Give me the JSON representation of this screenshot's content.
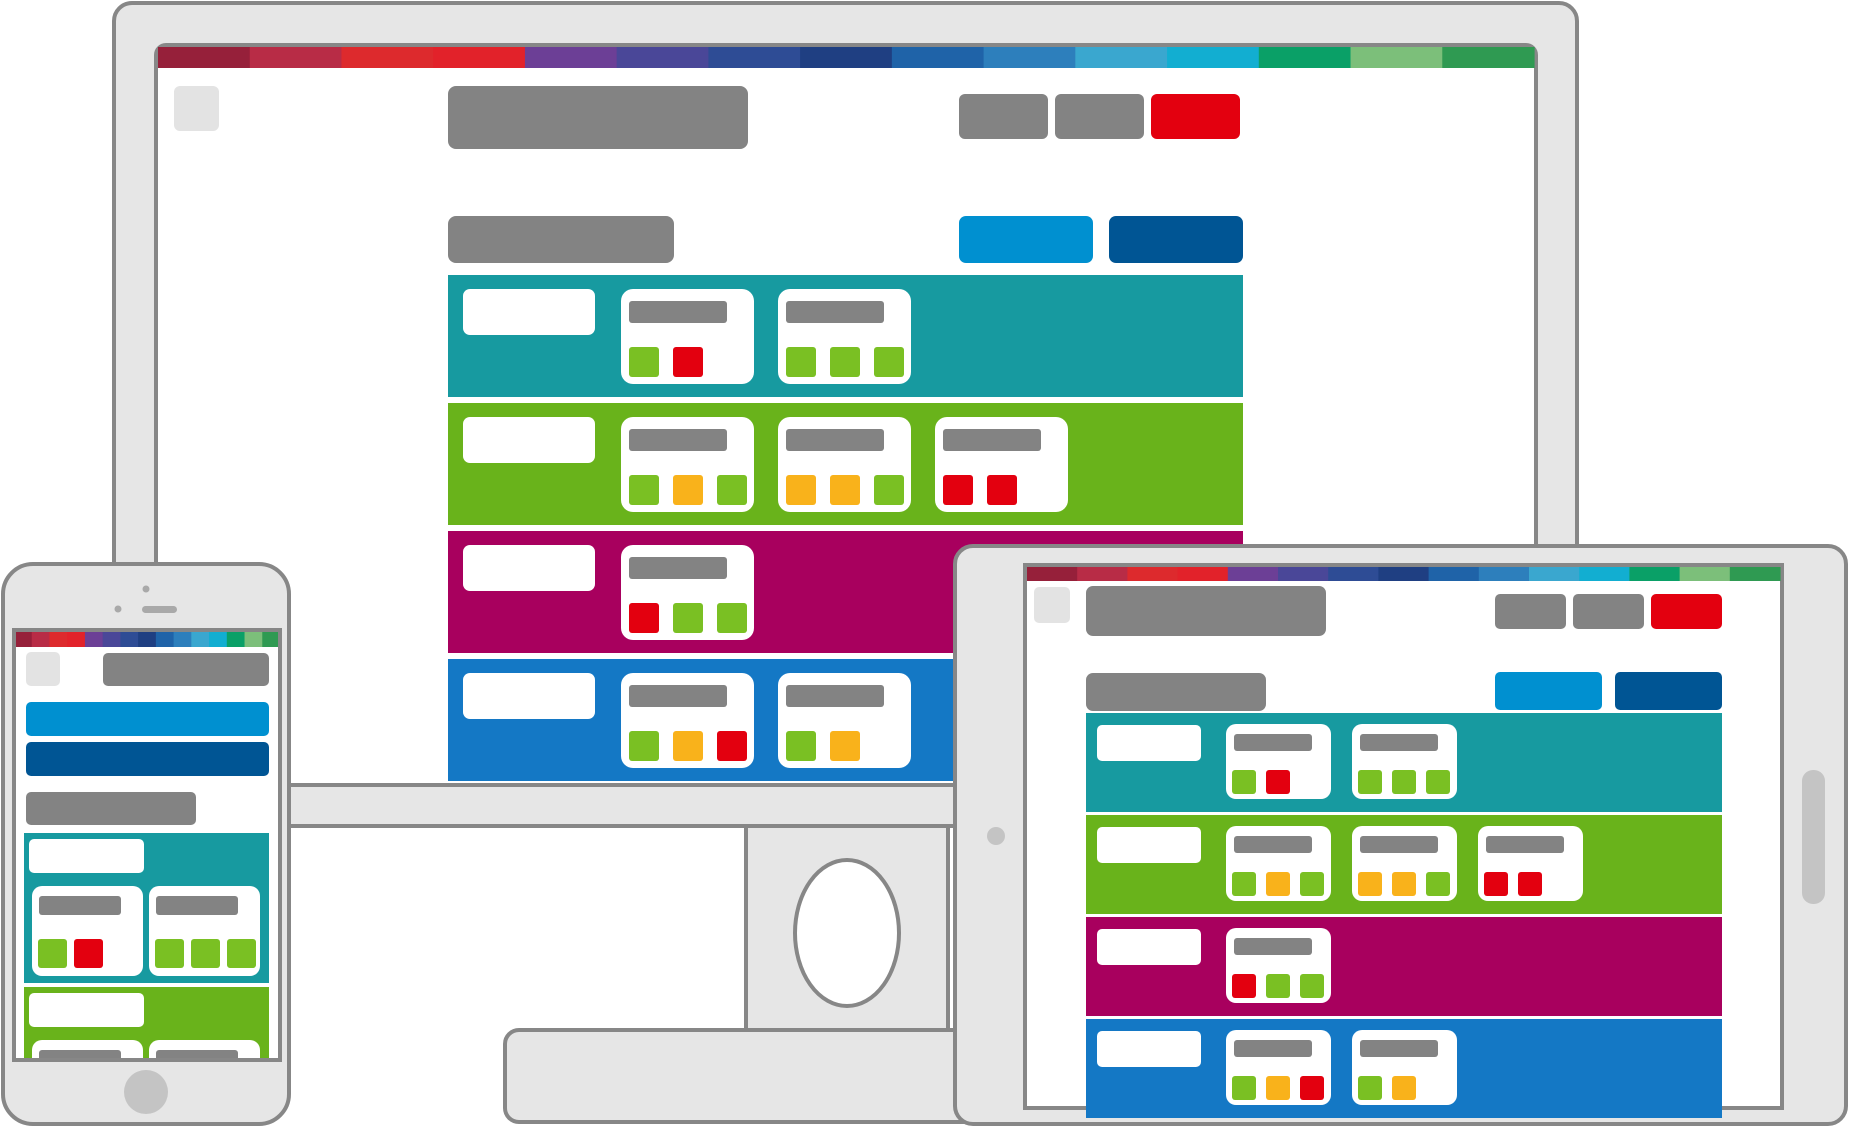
{
  "colors": {
    "device_frame": "#e6e6e6",
    "device_stroke": "#878787",
    "screen_bg": "#ffffff",
    "placeholder_gray": "#838383",
    "logo_gray": "#e3e3e3",
    "accent_red": "#e3000f",
    "button_blue": "#0090d0",
    "button_navy": "#005594",
    "lane_teal": "#179aa0",
    "lane_green": "#69b31b",
    "lane_magenta": "#a8005e",
    "lane_blue": "#1478c5",
    "status_green": "#7ac023",
    "status_amber": "#f9b21b",
    "status_red": "#e3000f"
  },
  "color_strip": [
    "#96203a",
    "#b82c46",
    "#dd2a2d",
    "#e2222a",
    "#6c3f96",
    "#4a4798",
    "#2e4c95",
    "#1f3f82",
    "#1f63a8",
    "#2d7fbc",
    "#3aa7cf",
    "#12aed1",
    "#0aa067",
    "#7cbf7a",
    "#2f9a52"
  ],
  "lanes": [
    {
      "color_key": "lane_teal",
      "cards": [
        [
          "green",
          "red"
        ],
        [
          "green",
          "green",
          "green"
        ]
      ]
    },
    {
      "color_key": "lane_green",
      "cards": [
        [
          "green",
          "amber",
          "green"
        ],
        [
          "amber",
          "amber",
          "green"
        ],
        [
          "red",
          "red"
        ]
      ]
    },
    {
      "color_key": "lane_magenta",
      "cards": [
        [
          "red",
          "green",
          "green"
        ]
      ]
    },
    {
      "color_key": "lane_blue",
      "cards": [
        [
          "green",
          "amber",
          "red"
        ],
        [
          "green",
          "amber"
        ]
      ]
    }
  ],
  "header_buttons": [
    "gray",
    "gray",
    "red"
  ],
  "action_buttons": [
    "blue",
    "navy"
  ],
  "icons": {
    "monitor_stand": "stand-icon",
    "tablet_home": "home-button-icon",
    "phone_home": "home-button-icon",
    "phone_camera": "camera-icon"
  }
}
